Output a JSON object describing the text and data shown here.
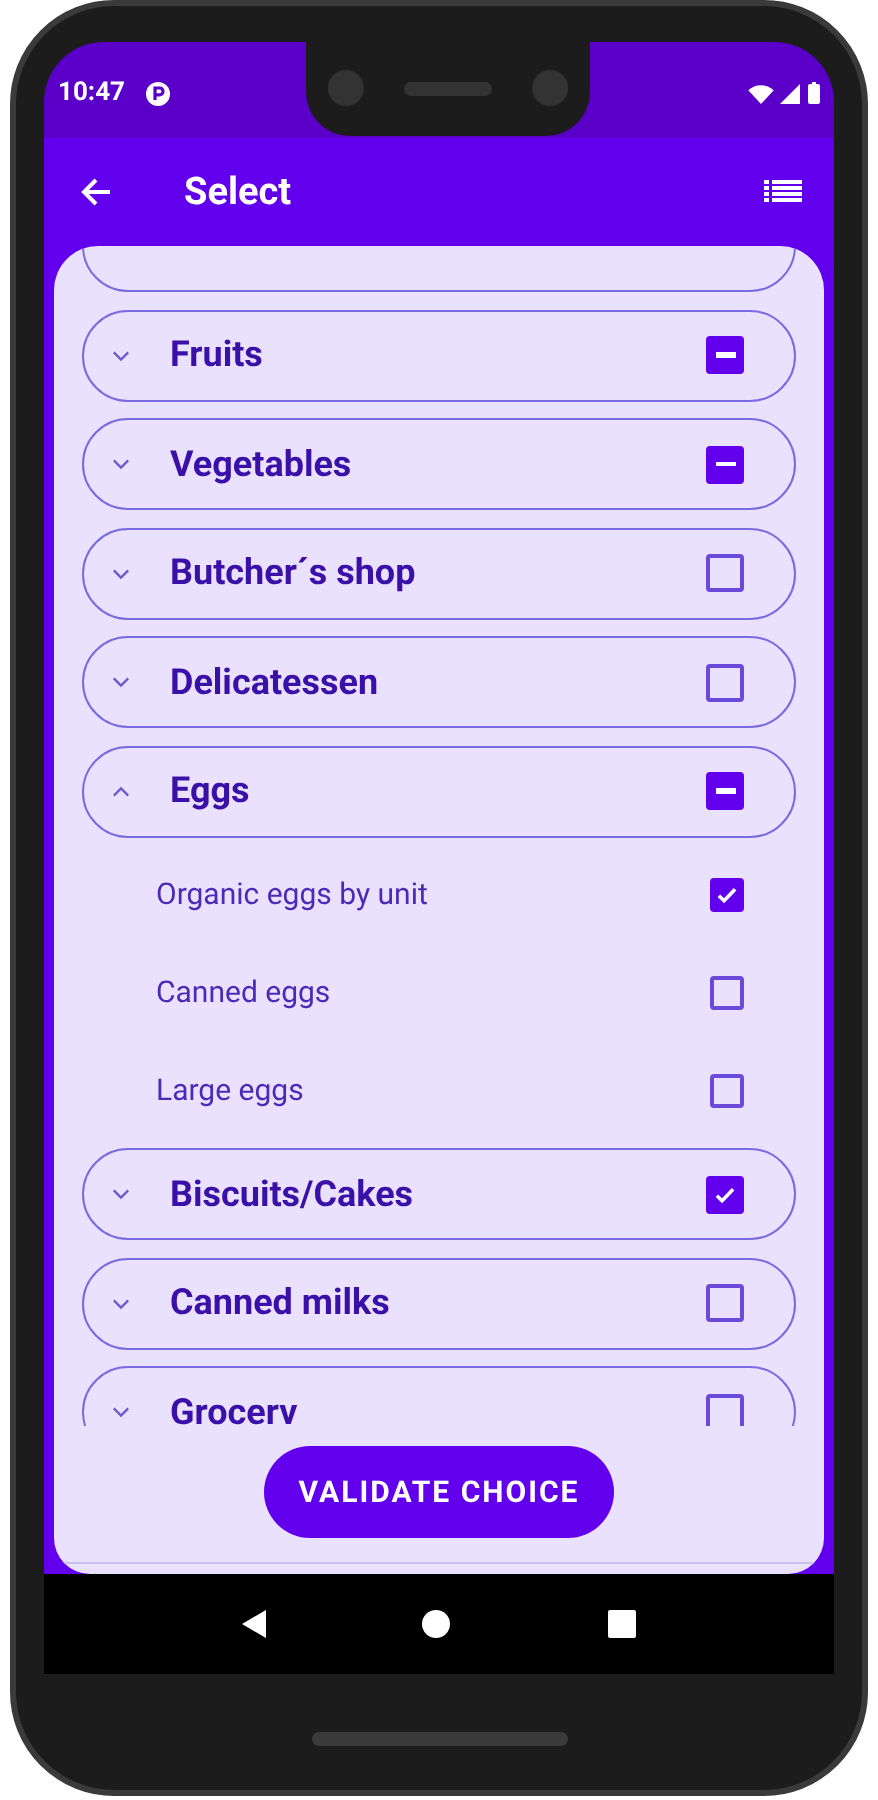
{
  "status_bar": {
    "time": "10:47"
  },
  "app_bar": {
    "title": "Select"
  },
  "categories": [
    {
      "label": "Fruits",
      "checked": true,
      "indeterminate": true,
      "expanded": false
    },
    {
      "label": "Vegetables",
      "checked": true,
      "indeterminate": true,
      "expanded": false
    },
    {
      "label": "Butcher´s shop",
      "checked": false,
      "indeterminate": false,
      "expanded": false
    },
    {
      "label": "Delicatessen",
      "checked": false,
      "indeterminate": false,
      "expanded": false
    },
    {
      "label": "Eggs",
      "checked": true,
      "indeterminate": true,
      "expanded": true,
      "children": [
        {
          "label": "Organic eggs by unit",
          "checked": true
        },
        {
          "label": "Canned eggs",
          "checked": false
        },
        {
          "label": "Large eggs",
          "checked": false
        }
      ]
    },
    {
      "label": "Biscuits/Cakes",
      "checked": true,
      "indeterminate": false,
      "expanded": false
    },
    {
      "label": "Canned milks",
      "checked": false,
      "indeterminate": false,
      "expanded": false
    },
    {
      "label": "Grocerv",
      "checked": false,
      "indeterminate": false,
      "expanded": false
    }
  ],
  "validate_button": "VALIDATE CHOICE"
}
